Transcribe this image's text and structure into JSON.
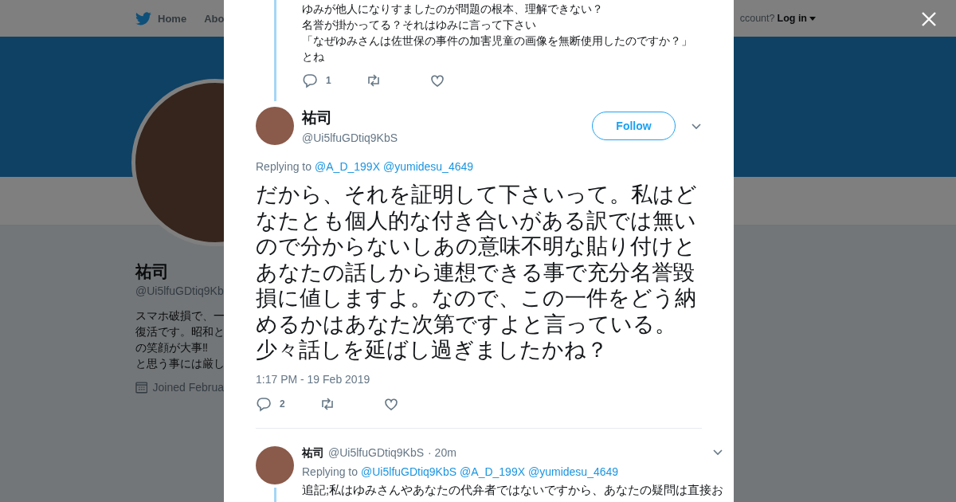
{
  "background_page": {
    "nav": {
      "items": [
        {
          "label": "Home",
          "kind": "home"
        },
        {
          "label": "Abo",
          "kind": "plain"
        }
      ],
      "login_prompt": "ccount?",
      "login": "Log in"
    },
    "profile": {
      "name": "祐司",
      "handle": "@Ui5lfuGDtiq9Kb",
      "bio_lines": [
        "スマホ破損で、一",
        "復活です。昭和と",
        "の笑顔が大事‼",
        "と思う事には厳し"
      ],
      "joined": "Joined Februa"
    }
  },
  "modal": {
    "tweets": [
      {
        "kind": "context",
        "text_lines": [
          "ゆみが他人になりすましたのが問題の根本、理解できない？",
          "名誉が掛かってる？それはゆみに言って下さい",
          "「なぜゆみさんは佐世保の事件の加害児童の画像を無断使用したのですか？」",
          "とね"
        ],
        "replies": "1"
      },
      {
        "kind": "focused",
        "name": "祐司",
        "handle": "@Ui5lfuGDtiq9KbS",
        "follow": "Follow",
        "replying_label": "Replying to",
        "mentions": [
          "@A_D_199X",
          "@yumidesu_4649"
        ],
        "text": "だから、それを証明して下さいって。私はどなたとも個人的な付き合いがある訳では無いので分からないしあの意味不明な貼り付けとあなたの話しから連想できる事で充分名誉毀損に値しますよ。なので、この一件をどう納めるかはあなた次第ですよと言っている。少々話しを延ばし過ぎましたかね？",
        "timestamp": "1:17 PM - 19 Feb 2019",
        "replies": "2"
      },
      {
        "kind": "reply",
        "name": "祐司",
        "handle": "@Ui5lfuGDtiq9KbS",
        "time": "· 20m",
        "replying_label": "Replying to",
        "mentions": [
          "@Ui5lfuGDtiq9KbS",
          "@A_D_199X",
          "@yumidesu_4649"
        ],
        "text_lines": [
          "追記;私はゆみさんやあなたの代弁者ではないですから、あなたの疑問は直接お"
        ]
      }
    ]
  }
}
